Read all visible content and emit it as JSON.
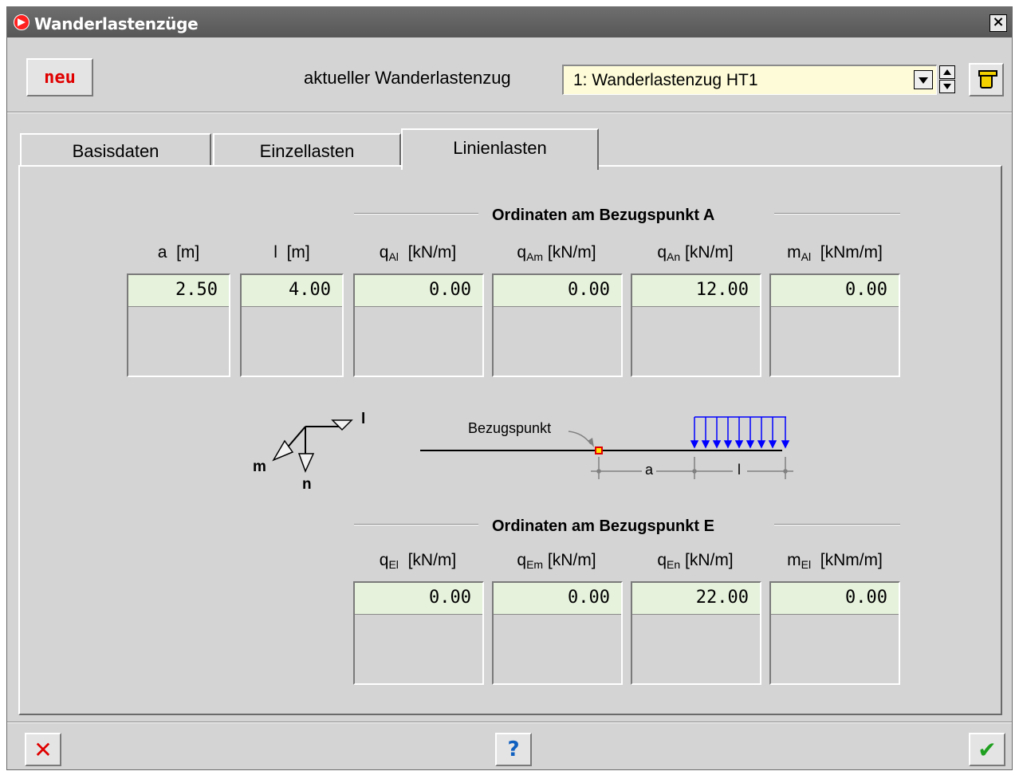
{
  "window": {
    "title": "Wanderlastenzüge",
    "close_label": "×"
  },
  "toolbar": {
    "neu_label": "neu",
    "current_label": "aktueller Wanderlastenzug",
    "current_value": "1: Wanderlastenzug HT1"
  },
  "tabs": [
    {
      "label": "Basisdaten",
      "active": false
    },
    {
      "label": "Einzellasten",
      "active": false
    },
    {
      "label": "Linienlasten",
      "active": true
    }
  ],
  "group_a": {
    "title": "Ordinaten am Bezugspunkt A",
    "columns": [
      {
        "sym": "a",
        "sub": "",
        "unit": "[m]",
        "value": "2.50"
      },
      {
        "sym": "l",
        "sub": "",
        "unit": "[m]",
        "value": "4.00"
      },
      {
        "sym": "q",
        "sub": "Al",
        "unit": "[kN/m]",
        "value": "0.00"
      },
      {
        "sym": "q",
        "sub": "Am",
        "unit": "[kN/m]",
        "value": "0.00"
      },
      {
        "sym": "q",
        "sub": "An",
        "unit": "[kN/m]",
        "value": "12.00"
      },
      {
        "sym": "m",
        "sub": "Al",
        "unit": "[kNm/m]",
        "value": "0.00"
      }
    ]
  },
  "group_e": {
    "title": "Ordinaten am Bezugspunkt E",
    "columns": [
      {
        "sym": "q",
        "sub": "El",
        "unit": "[kN/m]",
        "value": "0.00"
      },
      {
        "sym": "q",
        "sub": "Em",
        "unit": "[kN/m]",
        "value": "0.00"
      },
      {
        "sym": "q",
        "sub": "En",
        "unit": "[kN/m]",
        "value": "22.00"
      },
      {
        "sym": "m",
        "sub": "El",
        "unit": "[kNm/m]",
        "value": "0.00"
      }
    ]
  },
  "diagram": {
    "axis_l": "l",
    "axis_m": "m",
    "axis_n": "n",
    "bezugspunkt": "Bezugspunkt",
    "dim_a": "a",
    "dim_l": "l"
  },
  "colors": {
    "field_bg": "#e6f2dc",
    "select_bg": "#fdfbd8",
    "load_blue": "#0000ff",
    "accent_red": "#e00000"
  }
}
